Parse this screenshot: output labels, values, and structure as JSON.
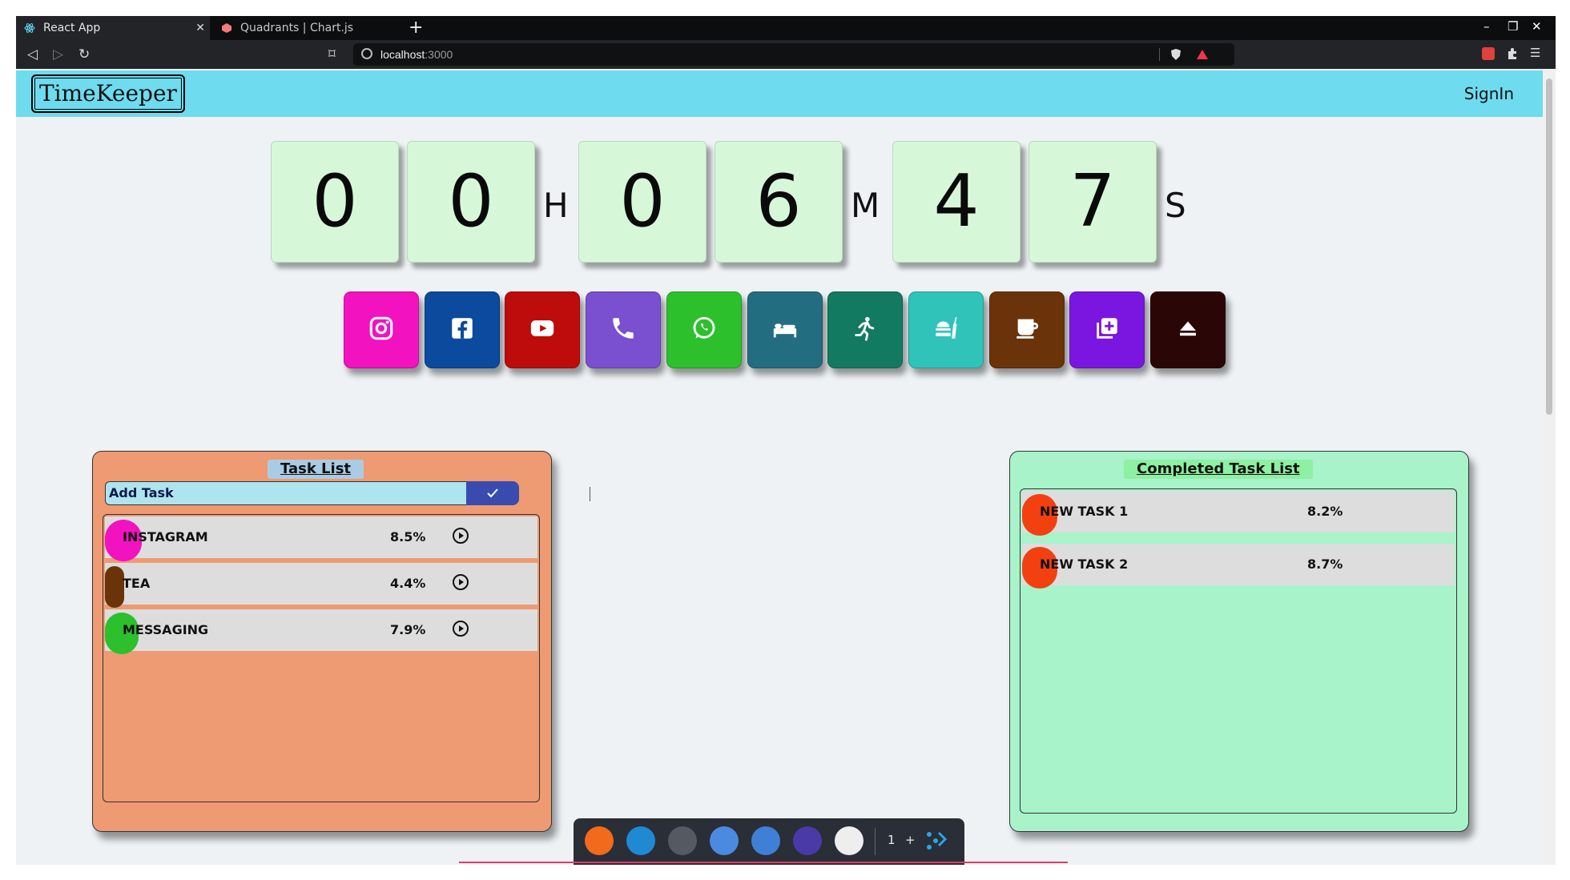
{
  "browser": {
    "tabs": [
      {
        "title": "React App",
        "active": true
      },
      {
        "title": "Quadrants | Chart.js",
        "active": false
      }
    ],
    "url_host": "localhost",
    "url_port": ":3000"
  },
  "app": {
    "brand": "TimeKeeper",
    "signin_label": "SignIn"
  },
  "timer": {
    "hours": [
      "0",
      "0"
    ],
    "minutes": [
      "0",
      "6"
    ],
    "seconds": [
      "4",
      "7"
    ],
    "h_unit": "H",
    "m_unit": "M",
    "s_unit": "S"
  },
  "activities": [
    {
      "icon": "instagram-icon",
      "color": "#f212c0"
    },
    {
      "icon": "facebook-icon",
      "color": "#0b4a9c"
    },
    {
      "icon": "youtube-icon",
      "color": "#be0b0b"
    },
    {
      "icon": "phone-icon",
      "color": "#7a4fd0"
    },
    {
      "icon": "whatsapp-icon",
      "color": "#2cc02c"
    },
    {
      "icon": "sleep-icon",
      "color": "#236d80"
    },
    {
      "icon": "run-icon",
      "color": "#127a60"
    },
    {
      "icon": "food-icon",
      "color": "#2fc3b9"
    },
    {
      "icon": "coffee-icon",
      "color": "#6b3309"
    },
    {
      "icon": "add-task-icon",
      "color": "#7b16e0"
    },
    {
      "icon": "eject-icon",
      "color": "#2b0606"
    }
  ],
  "task_list": {
    "title": "Task List",
    "input_value": "Add Task",
    "tasks": [
      {
        "name": "INSTAGRAM",
        "percent": "8.5%",
        "color": "#f212c0"
      },
      {
        "name": "TEA",
        "percent": "4.4%",
        "color": "#6b3309"
      },
      {
        "name": "MESSAGING",
        "percent": "7.9%",
        "color": "#2cc02c"
      }
    ]
  },
  "completed_list": {
    "title": "Completed Task List",
    "tasks": [
      {
        "name": "NEW TASK 1",
        "percent": "8.2%",
        "color": "#f24010"
      },
      {
        "name": "NEW TASK 2",
        "percent": "8.7%",
        "color": "#f24010"
      }
    ]
  },
  "dock": {
    "workspace_label": "1",
    "plus_label": "+"
  }
}
